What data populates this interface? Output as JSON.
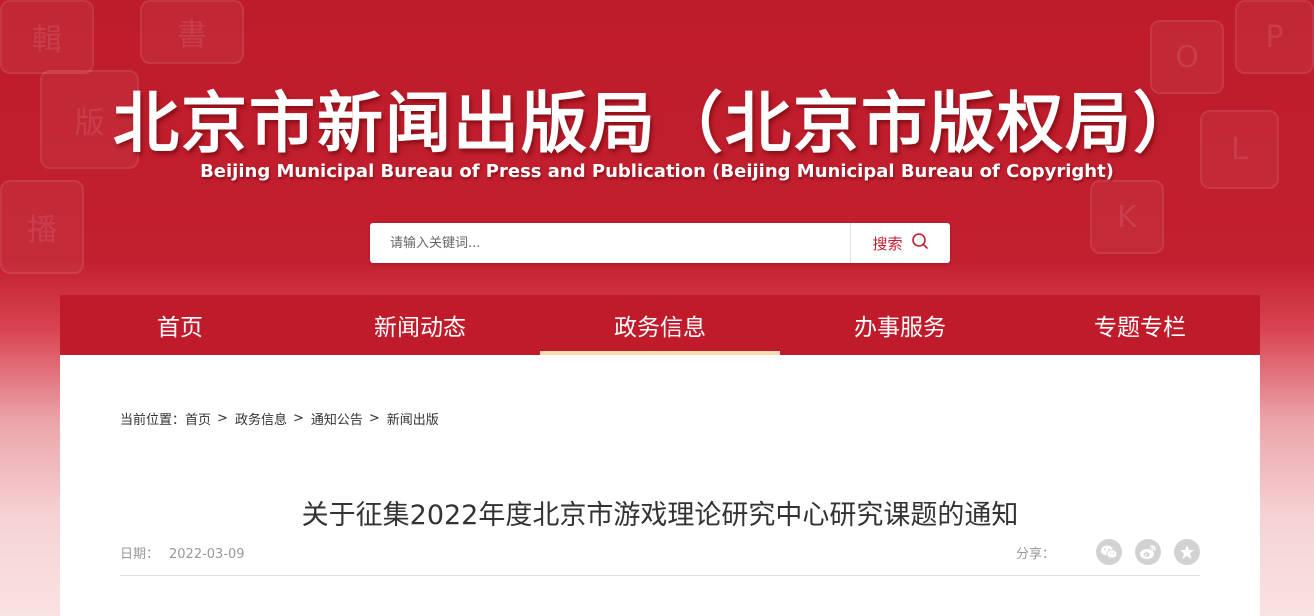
{
  "header": {
    "title": "北京市新闻出版局（北京市版权局）",
    "subtitle": "Beijing Municipal Bureau of Press and Publication (Beijing Municipal Bureau of Copyright)"
  },
  "search": {
    "placeholder": "请输入关键词...",
    "button_label": "搜索",
    "icon": "search-icon"
  },
  "nav": {
    "items": [
      {
        "label": "首页"
      },
      {
        "label": "新闻动态"
      },
      {
        "label": "政务信息",
        "active": true
      },
      {
        "label": "办事服务"
      },
      {
        "label": "专题专栏"
      }
    ]
  },
  "breadcrumb": {
    "prefix": "当前位置：",
    "items": [
      "首页",
      "政务信息",
      "通知公告",
      "新闻出版"
    ],
    "separator": ">"
  },
  "article": {
    "title": "关于征集2022年度北京市游戏理论研究中心研究课题的通知",
    "date_label": "日期：",
    "date": "2022-03-09",
    "share_label": "分享：",
    "share_icons": [
      "wechat-icon",
      "weibo-icon",
      "star-icon"
    ]
  },
  "colors": {
    "brand_red": "#c01b2b",
    "active_underline": "#f6dcb0",
    "share_icon_bg": "#d2d2d2"
  }
}
